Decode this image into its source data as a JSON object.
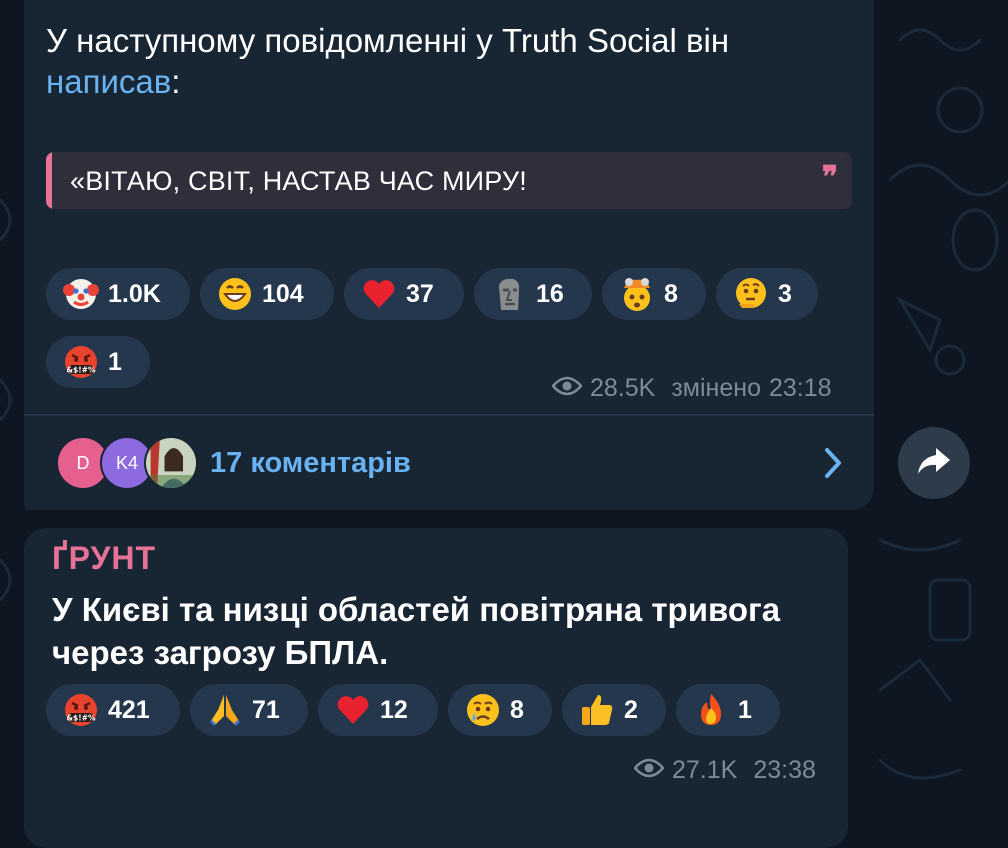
{
  "colors": {
    "background": "#0e1621",
    "bubble": "#182533",
    "link": "#6ab3f3",
    "quote_accent": "#e77297",
    "reaction_chip": "#24374d",
    "meta": "#7d8b99"
  },
  "message1": {
    "text_before_link": "У наступному повідомленні у Truth Social він",
    "link_text": "написав",
    "text_after_link": ":",
    "quote": "«ВІТАЮ, СВІТ, НАСТАВ ЧАС МИРУ!",
    "quote_icon": "quote-icon",
    "reactions": [
      {
        "emoji": "clown-face-icon",
        "count": "1.0K"
      },
      {
        "emoji": "grinning-face-icon",
        "count": "104"
      },
      {
        "emoji": "red-heart-icon",
        "count": "37"
      },
      {
        "emoji": "moai-icon",
        "count": "16"
      },
      {
        "emoji": "exploding-head-icon",
        "count": "8"
      },
      {
        "emoji": "thinking-face-icon",
        "count": "3"
      },
      {
        "emoji": "cursing-face-icon",
        "count": "1"
      }
    ],
    "views": "28.5K",
    "edited_label": "змінено",
    "time": "23:18",
    "comments": {
      "avatars": [
        {
          "label": "D",
          "color": "#e5608f"
        },
        {
          "label": "K4",
          "color": "#8d6ae0"
        },
        {
          "label": "",
          "color": "#5a7a3c"
        }
      ],
      "label": "17 коментарів"
    }
  },
  "message2": {
    "sender": "ҐРУНТ",
    "text_line1": "У Києві та низці областей повітряна тривога",
    "text_line2": "через загрозу БПЛА.",
    "reactions": [
      {
        "emoji": "cursing-face-icon",
        "count": "421"
      },
      {
        "emoji": "folded-hands-icon",
        "count": "71"
      },
      {
        "emoji": "red-heart-icon",
        "count": "12"
      },
      {
        "emoji": "crying-face-icon",
        "count": "8"
      },
      {
        "emoji": "thumbs-up-icon",
        "count": "2"
      },
      {
        "emoji": "fire-icon",
        "count": "1"
      }
    ],
    "views": "27.1K",
    "time": "23:38"
  }
}
